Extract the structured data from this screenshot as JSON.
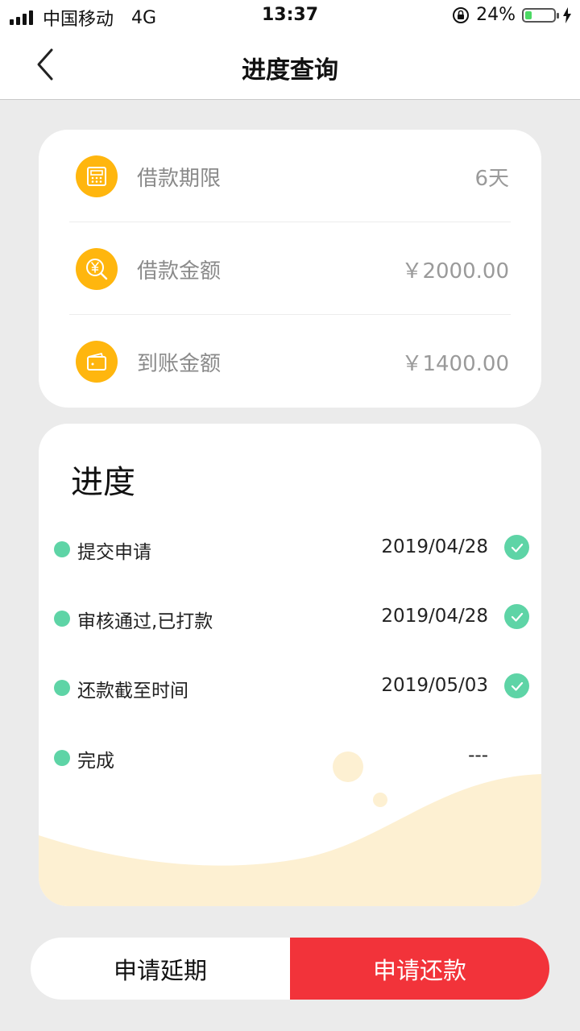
{
  "status_bar": {
    "carrier": "中国移动",
    "network": "4G",
    "time": "13:37",
    "battery_percent": "24%",
    "battery_level": 0.24
  },
  "nav": {
    "title": "进度查询",
    "back_icon": "chevron-left-icon"
  },
  "info": {
    "items": [
      {
        "label": "借款期限",
        "value": "6天",
        "icon": "calculator-icon"
      },
      {
        "label": "借款金额",
        "value": "￥2000.00",
        "icon": "yuan-search-icon"
      },
      {
        "label": "到账金额",
        "value": "￥1400.00",
        "icon": "wallet-icon"
      }
    ]
  },
  "progress": {
    "title": "进度",
    "steps": [
      {
        "name": "提交申请",
        "date": "2019/04/28",
        "done": true
      },
      {
        "name": "审核通过,已打款",
        "date": "2019/04/28",
        "done": true
      },
      {
        "name": "还款截至时间",
        "date": "2019/05/03",
        "done": true
      },
      {
        "name": "完成",
        "date": "---",
        "done": false
      }
    ]
  },
  "actions": {
    "extend_label": "申请延期",
    "repay_label": "申请还款"
  },
  "colors": {
    "accent_yellow": "#ffb60e",
    "step_green": "#5ed4a6",
    "repay_red": "#f2333a",
    "wave_cream": "#fdf0d2"
  }
}
